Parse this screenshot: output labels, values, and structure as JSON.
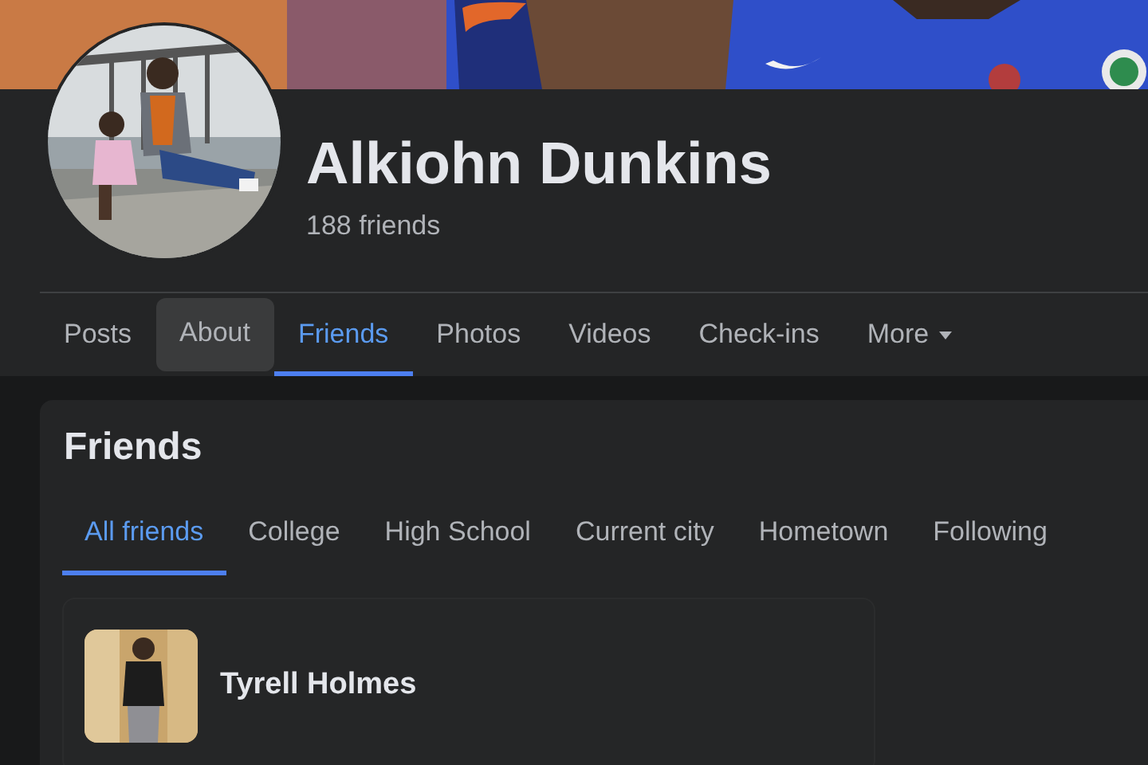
{
  "profile": {
    "name": "Alkiohn Dunkins",
    "friend_count": "188 friends"
  },
  "tabs": [
    {
      "label": "Posts",
      "selected": false,
      "hovered": false
    },
    {
      "label": "About",
      "selected": false,
      "hovered": true
    },
    {
      "label": "Friends",
      "selected": true,
      "hovered": false
    },
    {
      "label": "Photos",
      "selected": false,
      "hovered": false
    },
    {
      "label": "Videos",
      "selected": false,
      "hovered": false
    },
    {
      "label": "Check-ins",
      "selected": false,
      "hovered": false
    },
    {
      "label": "More",
      "selected": false,
      "hovered": false,
      "dropdown": true
    }
  ],
  "friends_section": {
    "title": "Friends",
    "filters": [
      {
        "label": "All friends",
        "selected": true
      },
      {
        "label": "College",
        "selected": false
      },
      {
        "label": "High School",
        "selected": false
      },
      {
        "label": "Current city",
        "selected": false
      },
      {
        "label": "Hometown",
        "selected": false
      },
      {
        "label": "Following",
        "selected": false
      }
    ],
    "friends": [
      {
        "name": "Tyrell Holmes"
      }
    ]
  }
}
